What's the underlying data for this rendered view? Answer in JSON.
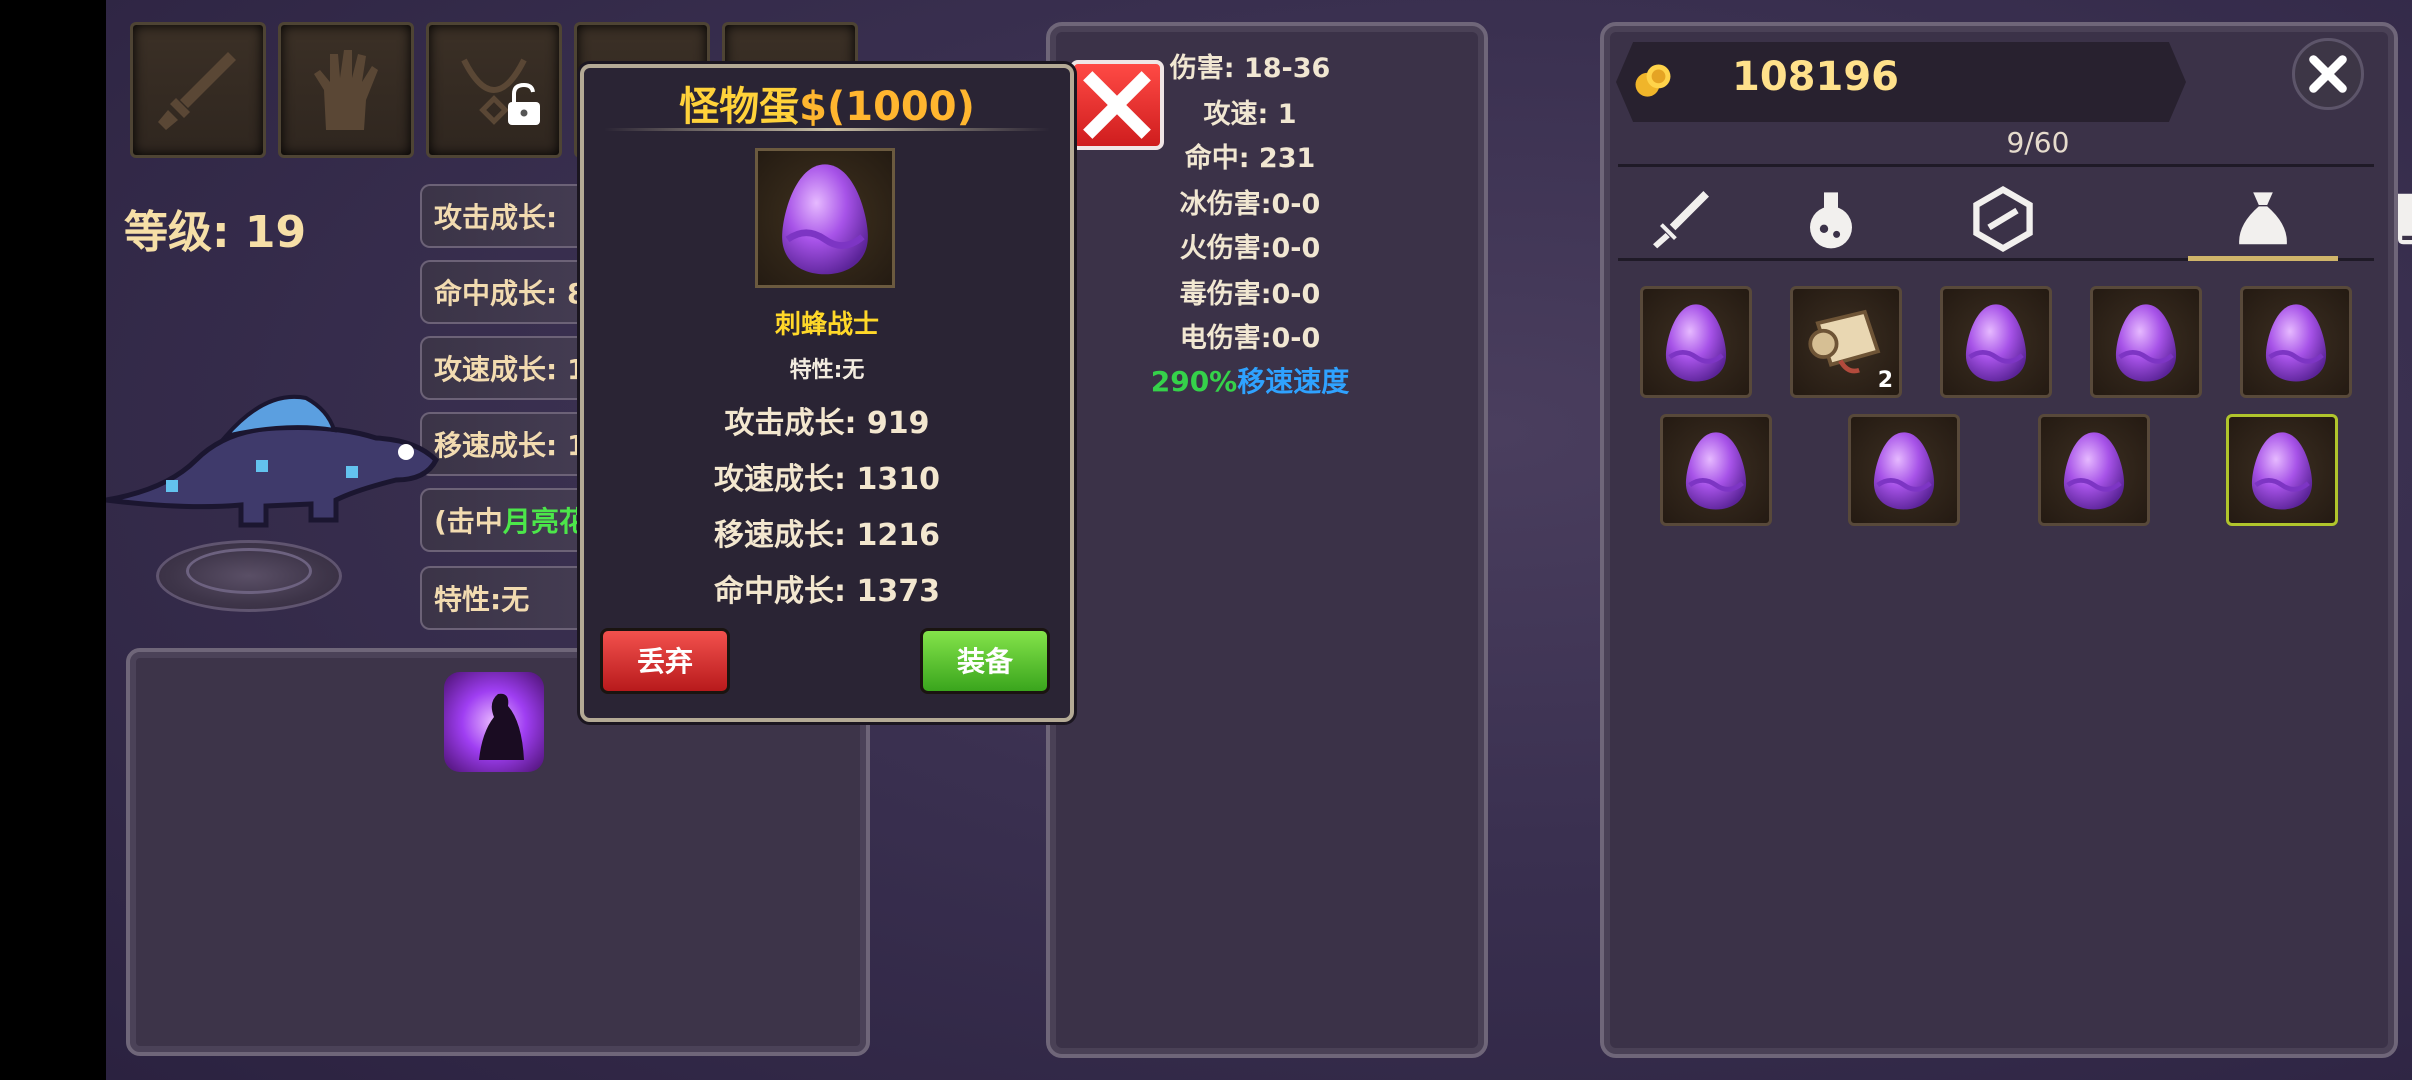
{
  "character": {
    "level_label": "等级: 19",
    "stats": [
      "攻击成长: ",
      "命中成长: 8",
      "攻速成长: 1",
      "移速成长: 1",
      "(击中",
      "特性:无"
    ],
    "stat_green": "月亮花"
  },
  "popup": {
    "title": "怪物蛋",
    "price": "$(1000)",
    "monster_name": "刺蜂战士",
    "trait": "特性:无",
    "stats": [
      "攻击成长: 919",
      "攻速成长: 1310",
      "移速成长: 1216",
      "命中成长: 1373"
    ],
    "discard_label": "丢弃",
    "equip_label": "装备"
  },
  "detail": {
    "stats": [
      "伤害:  18-36",
      "攻速: 1",
      "命中: 231",
      "冰伤害:0-0",
      "火伤害:0-0",
      "毒伤害:0-0",
      "电伤害:0-0"
    ],
    "speed_pct": "290%",
    "speed_text": "移速速度"
  },
  "inventory": {
    "gold": "108196",
    "capacity": "9/60",
    "tabs": [
      "sword-icon",
      "potion-icon",
      "gem-icon",
      "bag-icon",
      "book-icon"
    ],
    "active_tab": "bag-icon",
    "items": [
      {
        "type": "egg-icon"
      },
      {
        "type": "scroll-icon",
        "count": "2"
      },
      {
        "type": "egg-icon"
      },
      {
        "type": "egg-icon"
      },
      {
        "type": "egg-icon"
      },
      {
        "type": "egg-icon"
      },
      {
        "type": "egg-icon"
      },
      {
        "type": "egg-icon"
      },
      {
        "type": "egg-icon",
        "selected": true
      }
    ]
  },
  "colors": {
    "gold": "#ffe18b",
    "title": "#ffd23a",
    "green": "#4ce64a",
    "blue": "#2fa2ff"
  }
}
